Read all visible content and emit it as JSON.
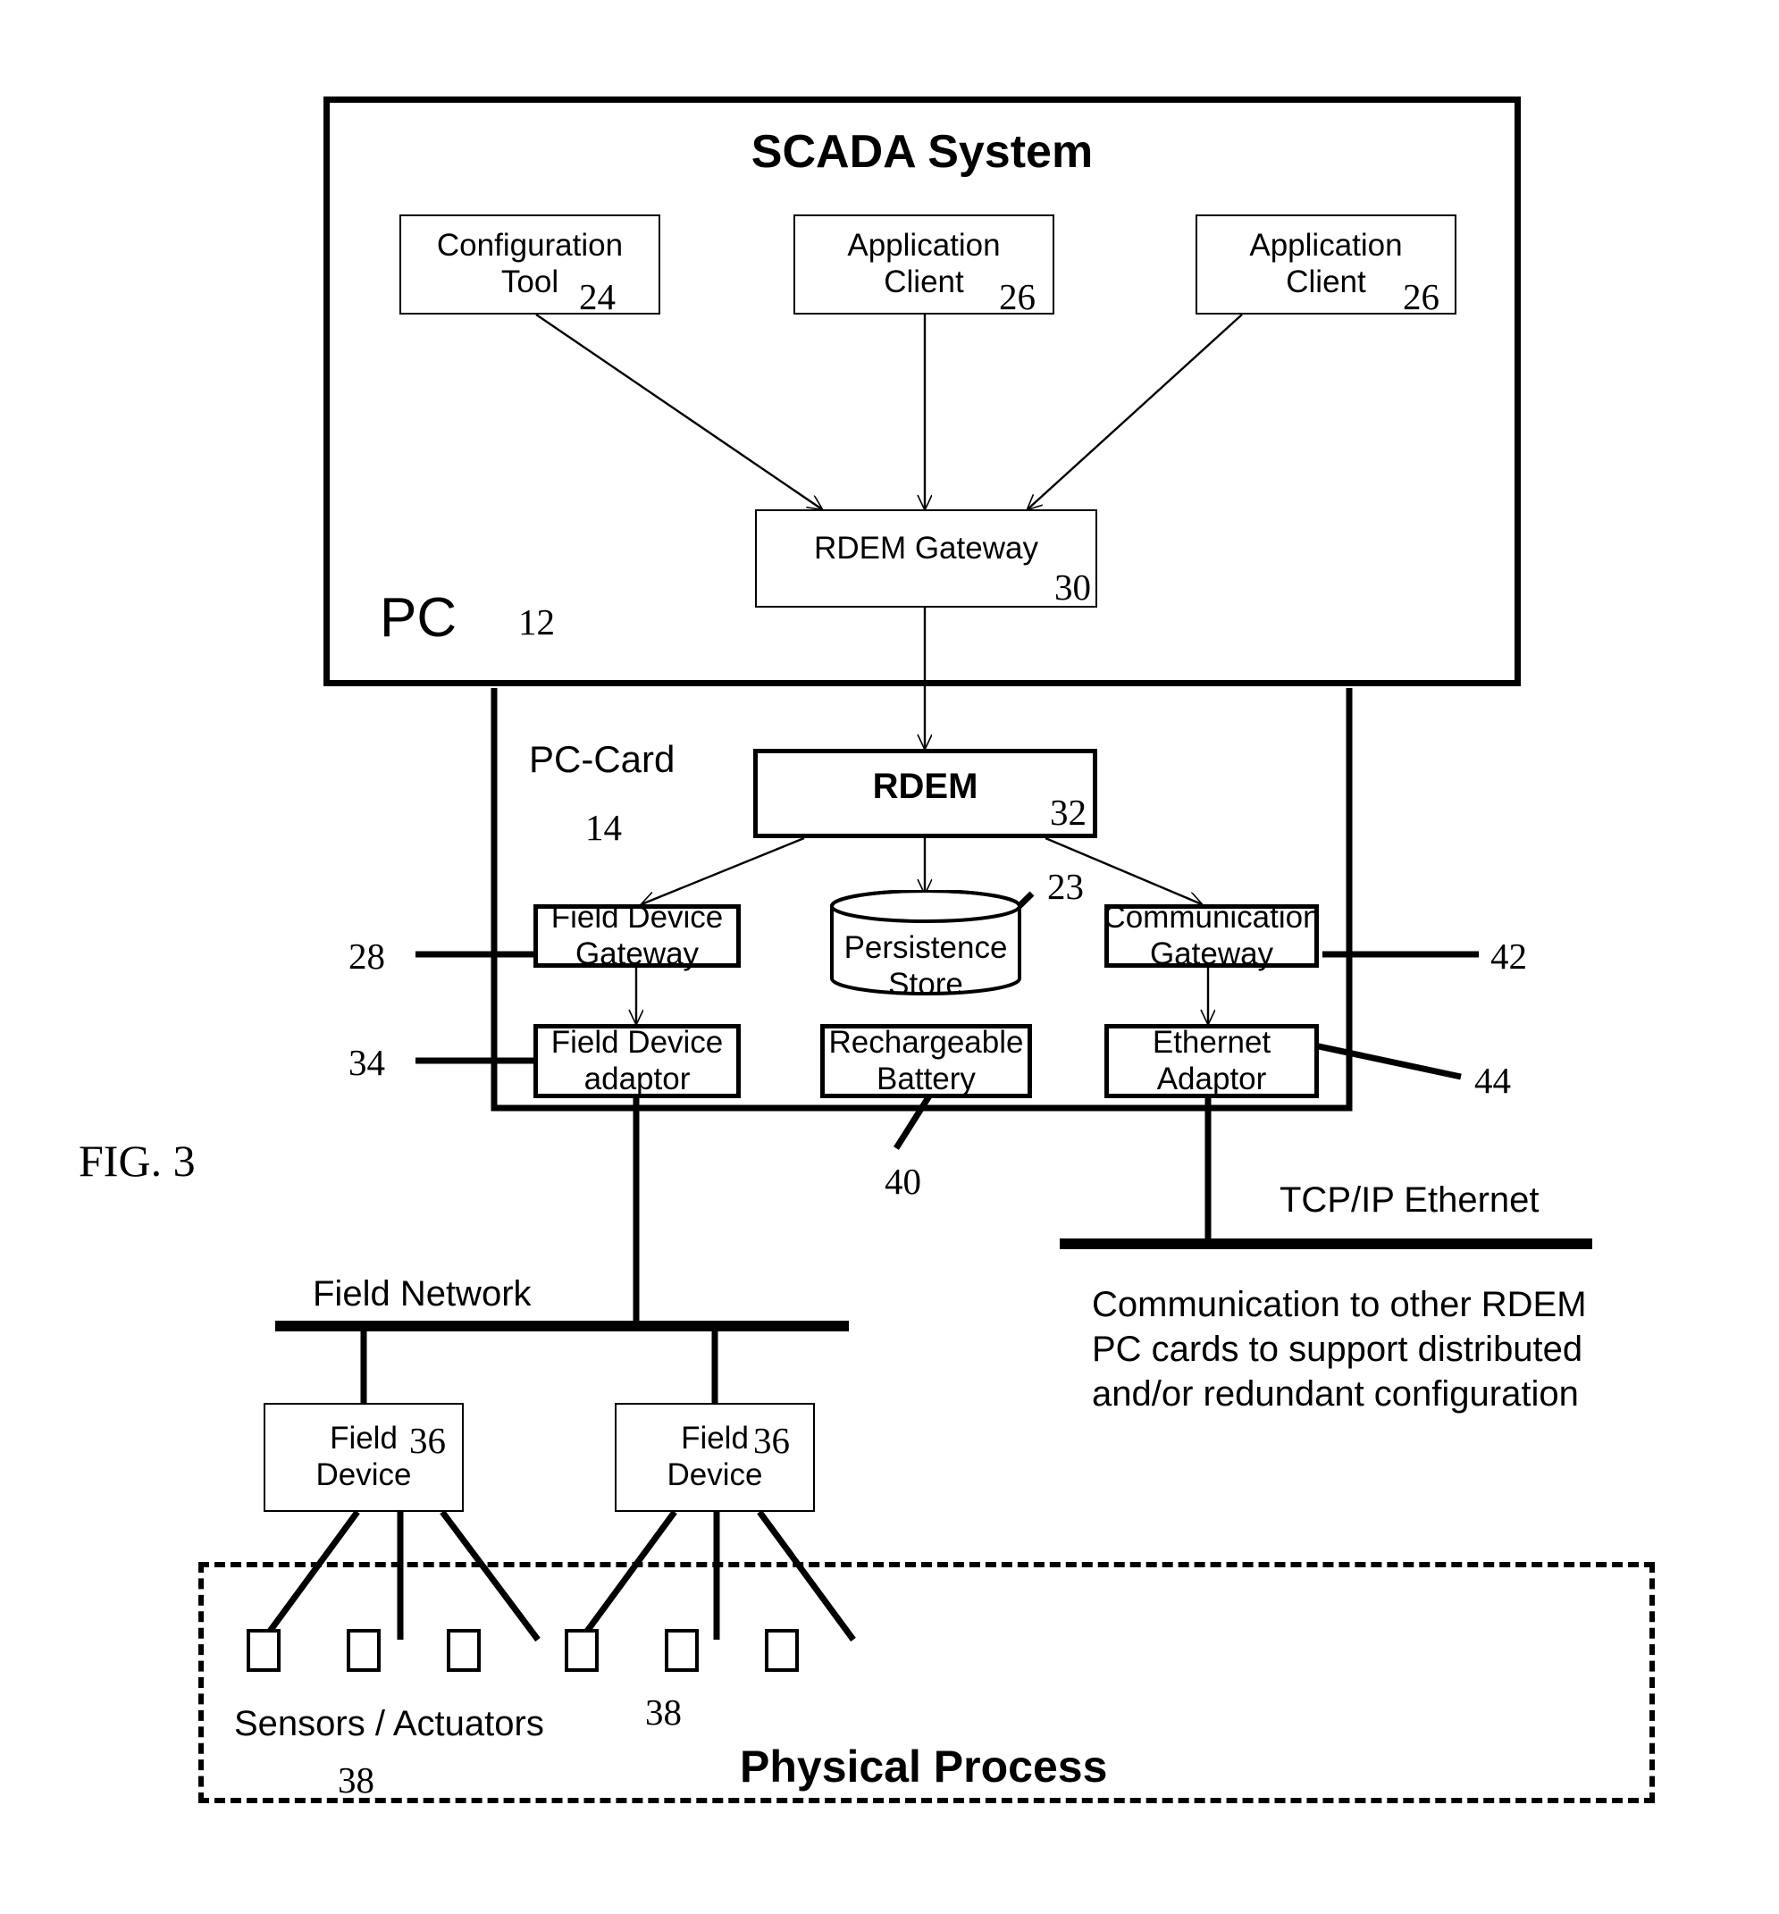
{
  "figure": {
    "label": "FIG. 3",
    "title_outer": "SCADA System"
  },
  "scada": {
    "title": "SCADA System",
    "boxes": [
      {
        "line1": "Configuration",
        "line2": "Tool",
        "ref": "24"
      },
      {
        "line1": "Application",
        "line2": "Client",
        "ref": "26"
      },
      {
        "line1": "Application",
        "line2": "Client",
        "ref": "26"
      }
    ],
    "gateway": {
      "label": "RDEM Gateway",
      "ref": "30"
    },
    "pc_label": "PC",
    "pc_ref": "12"
  },
  "pccard": {
    "label": "PC-Card",
    "ref": "14",
    "rdem": {
      "label": "RDEM",
      "ref": "32"
    },
    "field_device_gateway": {
      "line1": "Field Device",
      "line2": "Gateway",
      "ref": "28"
    },
    "persistence_store": {
      "line1": "Persistence",
      "line2": "Store",
      "ref": "23"
    },
    "communication_gateway": {
      "line1": "Communication",
      "line2": "Gateway",
      "ref": "42"
    },
    "field_device_adaptor": {
      "line1": "Field Device",
      "line2": "adaptor",
      "ref": "34"
    },
    "rechargeable_battery": {
      "line1": "Rechargeable",
      "line2": "Battery",
      "ref": "40"
    },
    "ethernet_adaptor": {
      "line1": "Ethernet",
      "line2": "Adaptor",
      "ref": "44"
    }
  },
  "networks": {
    "tcpip_label": "TCP/IP Ethernet",
    "tcpip_note_line1": "Communication to other RDEM",
    "tcpip_note_line2": "PC cards to support distributed",
    "tcpip_note_line3": "and/or redundant configuration",
    "field_network_label": "Field Network"
  },
  "field_devices": [
    {
      "line1": "Field",
      "line2": "Device",
      "ref": "36"
    },
    {
      "line1": "Field",
      "line2": "Device",
      "ref": "36"
    }
  ],
  "physical_process": {
    "title": "Physical Process",
    "sensors_label": "Sensors / Actuators",
    "ref_left": "38",
    "ref_right": "38"
  },
  "colors": {
    "stroke": "#000000",
    "background": "#ffffff"
  }
}
